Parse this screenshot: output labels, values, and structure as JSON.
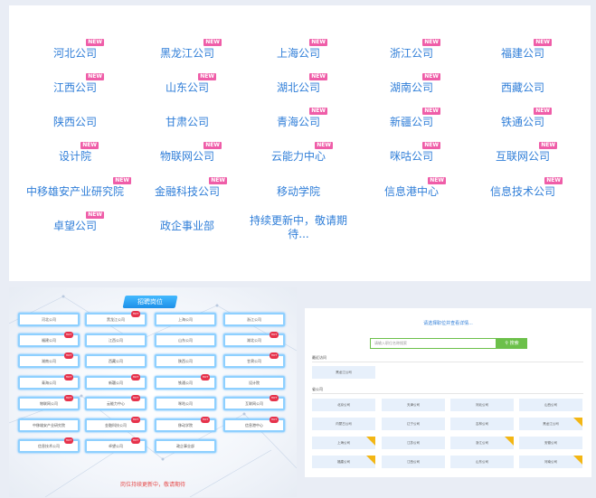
{
  "companies": [
    {
      "name": "河北公司",
      "is_new": true
    },
    {
      "name": "黑龙江公司",
      "is_new": true
    },
    {
      "name": "上海公司",
      "is_new": true
    },
    {
      "name": "浙江公司",
      "is_new": true
    },
    {
      "name": "福建公司",
      "is_new": true
    },
    {
      "name": "江西公司",
      "is_new": true
    },
    {
      "name": "山东公司",
      "is_new": true
    },
    {
      "name": "湖北公司",
      "is_new": true
    },
    {
      "name": "湖南公司",
      "is_new": true
    },
    {
      "name": "西藏公司",
      "is_new": false
    },
    {
      "name": "陕西公司",
      "is_new": false
    },
    {
      "name": "甘肃公司",
      "is_new": false
    },
    {
      "name": "青海公司",
      "is_new": true
    },
    {
      "name": "新疆公司",
      "is_new": true
    },
    {
      "name": "铁通公司",
      "is_new": true
    },
    {
      "name": "设计院",
      "is_new": true
    },
    {
      "name": "物联网公司",
      "is_new": true
    },
    {
      "name": "云能力中心",
      "is_new": true
    },
    {
      "name": "咪咕公司",
      "is_new": true
    },
    {
      "name": "互联网公司",
      "is_new": true
    },
    {
      "name": "中移雄安产业研究院",
      "is_new": true
    },
    {
      "name": "金融科技公司",
      "is_new": true
    },
    {
      "name": "移动学院",
      "is_new": false
    },
    {
      "name": "信息港中心",
      "is_new": true
    },
    {
      "name": "信息技术公司",
      "is_new": true
    },
    {
      "name": "卓望公司",
      "is_new": true
    },
    {
      "name": "政企事业部",
      "is_new": false
    },
    {
      "name": "持续更新中，敬请期待...",
      "is_new": false
    }
  ],
  "new_badge": "NEW",
  "recruit": {
    "title": "招聘岗位",
    "hot_label": "HOT",
    "cells": [
      {
        "name": "河北公司",
        "hot": false
      },
      {
        "name": "黑龙江公司",
        "hot": true
      },
      {
        "name": "上海公司",
        "hot": false
      },
      {
        "name": "浙江公司",
        "hot": false
      },
      {
        "name": "福建公司",
        "hot": true
      },
      {
        "name": "江西公司",
        "hot": false
      },
      {
        "name": "山东公司",
        "hot": false
      },
      {
        "name": "湖北公司",
        "hot": true
      },
      {
        "name": "湖南公司",
        "hot": true
      },
      {
        "name": "西藏公司",
        "hot": false
      },
      {
        "name": "陕西公司",
        "hot": false
      },
      {
        "name": "甘肃公司",
        "hot": true
      },
      {
        "name": "青海公司",
        "hot": true
      },
      {
        "name": "新疆公司",
        "hot": true
      },
      {
        "name": "铁通公司",
        "hot": true
      },
      {
        "name": "设计院",
        "hot": false
      },
      {
        "name": "物联网公司",
        "hot": true
      },
      {
        "name": "云能力中心",
        "hot": true
      },
      {
        "name": "咪咕公司",
        "hot": false
      },
      {
        "name": "互联网公司",
        "hot": true
      },
      {
        "name": "中移雄安产业研究院",
        "hot": false
      },
      {
        "name": "金融科技公司",
        "hot": true
      },
      {
        "name": "移动学院",
        "hot": true
      },
      {
        "name": "信息港中心",
        "hot": true
      },
      {
        "name": "信息技术公司",
        "hot": true
      },
      {
        "name": "卓望公司",
        "hot": true
      },
      {
        "name": "政企事业部",
        "hot": false
      }
    ],
    "footer": "岗位持续更新中，敬请期待"
  },
  "search_panel": {
    "hint": "请选择职位并查看详情...",
    "placeholder": "请输入职位名称搜索",
    "button": "搜索",
    "recent_label": "最近访问",
    "recent_item": "黑龙江公司",
    "province_label": "省公司",
    "tiles": [
      {
        "name": "北京公司",
        "new": false
      },
      {
        "name": "天津公司",
        "new": false
      },
      {
        "name": "河北公司",
        "new": false
      },
      {
        "name": "山西公司",
        "new": false
      },
      {
        "name": "内蒙古公司",
        "new": false
      },
      {
        "name": "辽宁公司",
        "new": false
      },
      {
        "name": "吉林公司",
        "new": false
      },
      {
        "name": "黑龙江公司",
        "new": true
      },
      {
        "name": "上海公司",
        "new": true
      },
      {
        "name": "江苏公司",
        "new": false
      },
      {
        "name": "浙江公司",
        "new": true
      },
      {
        "name": "安徽公司",
        "new": false
      },
      {
        "name": "福建公司",
        "new": true
      },
      {
        "name": "江西公司",
        "new": false
      },
      {
        "name": "山东公司",
        "new": false
      },
      {
        "name": "河南公司",
        "new": true
      }
    ]
  },
  "colors": {
    "link": "#2f7ed8",
    "new_badge": "#ef5da8",
    "hot": "#e6324b",
    "search_green": "#6cc04a",
    "corner_gold": "#f3b614"
  }
}
